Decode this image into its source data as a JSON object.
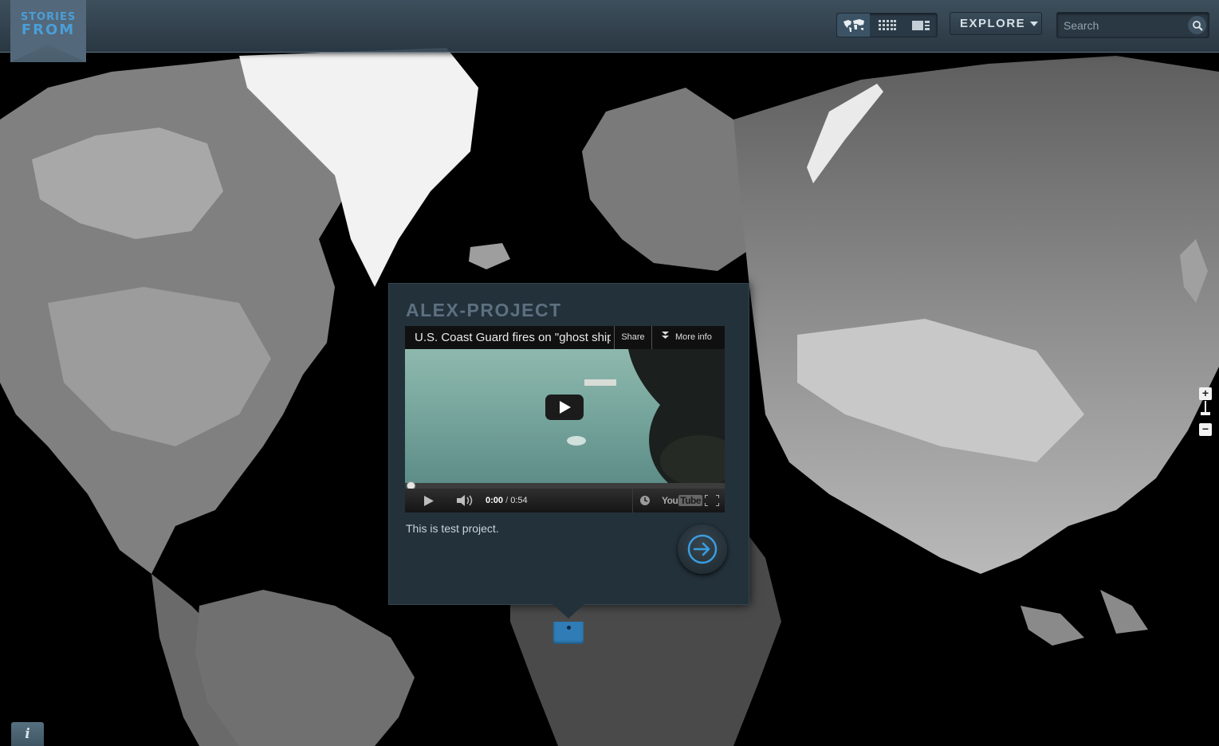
{
  "app": {
    "logo_line1": "STORIES",
    "logo_line2": "FROM"
  },
  "toolbar": {
    "view_modes": [
      {
        "icon": "world-map-icon",
        "active": true
      },
      {
        "icon": "grid-icon",
        "active": false
      },
      {
        "icon": "list-icon",
        "active": false
      }
    ],
    "explore_label": "EXPLORE",
    "search_placeholder": "Search",
    "search_value": ""
  },
  "popup": {
    "title": "ALEX-PROJECT",
    "description": "This is test project.",
    "video": {
      "title": "U.S. Coast Guard fires on \"ghost ship\"",
      "share_label": "Share",
      "more_info_label": "More info",
      "current_time": "0:00",
      "separator": " / ",
      "duration": "0:54",
      "played_fraction": 0,
      "provider": "YouTube"
    }
  },
  "map": {
    "zoom_in_label": "+",
    "zoom_out_label": "−"
  },
  "info_button_label": "i",
  "colors": {
    "accent": "#2f7cb7",
    "logo_text": "#4b9ed8",
    "popup_bg": "#23313b",
    "title": "#5d7080"
  }
}
